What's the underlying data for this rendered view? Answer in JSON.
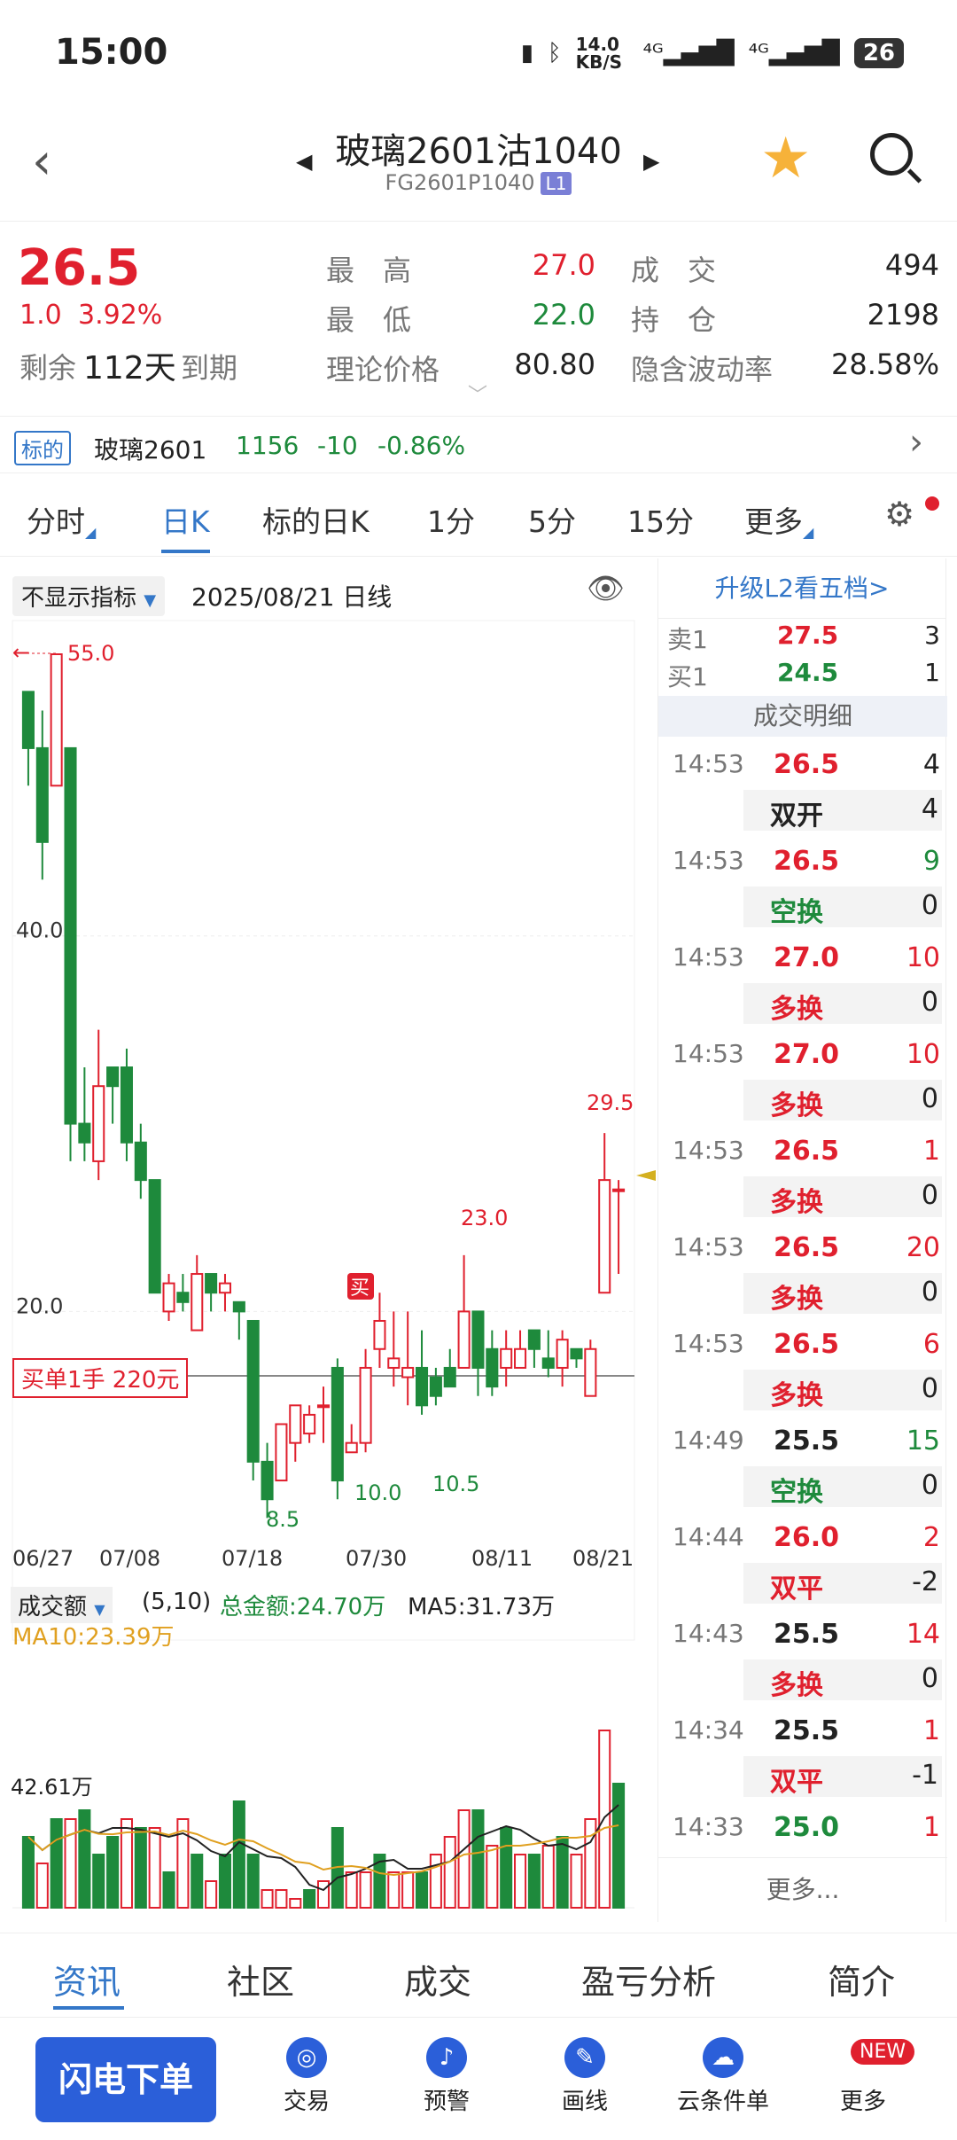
{
  "status": {
    "time": "15:00",
    "net_speed": "14.0 KB/S",
    "battery": "26"
  },
  "header": {
    "title": "玻璃2601沽1040",
    "code": "FG2601P1040",
    "level": "L1"
  },
  "quote": {
    "last": "26.5",
    "change": "1.0",
    "change_pct": "3.92%",
    "remain_label": "剩余",
    "remain_days": "112天",
    "remain_suffix": "到期",
    "high_label": "最　高",
    "high": "27.0",
    "low_label": "最　低",
    "low": "22.0",
    "theory_label": "理论价格",
    "theory": "80.80",
    "vol_label": "成　交",
    "vol": "494",
    "oi_label": "持　仓",
    "oi": "2198",
    "iv_label": "隐含波动率",
    "iv": "28.58%"
  },
  "underlying": {
    "tag": "标的",
    "name": "玻璃2601",
    "price": "1156",
    "chg": "-10",
    "pct": "-0.86%"
  },
  "tabs": [
    "分时",
    "日K",
    "标的日K",
    "1分",
    "5分",
    "15分",
    "更多"
  ],
  "chart_controls": {
    "indicator": "不显示指标",
    "date": "2025/08/21",
    "period": "日线"
  },
  "chart_data": {
    "type": "candlestick",
    "y_ticks": [
      "40.0",
      "20.0"
    ],
    "x_labels": [
      "06/27",
      "07/08",
      "07/18",
      "07/30",
      "08/11",
      "08/21"
    ],
    "annotations": {
      "max": "55.0",
      "min1": "8.5",
      "min2": "10.0",
      "min3": "10.5",
      "high1": "23.0",
      "high2": "29.5",
      "buy_tag": "买"
    },
    "order_line_label": "买单1手  220元",
    "candles": [
      {
        "o": 53,
        "c": 50,
        "h": 53,
        "l": 48
      },
      {
        "o": 50,
        "c": 45,
        "h": 52,
        "l": 43
      },
      {
        "o": 48,
        "c": 55,
        "h": 55,
        "l": 48
      },
      {
        "o": 50,
        "c": 30,
        "h": 50,
        "l": 28
      },
      {
        "o": 30,
        "c": 29,
        "h": 33,
        "l": 28
      },
      {
        "o": 28,
        "c": 32,
        "h": 35,
        "l": 27
      },
      {
        "o": 33,
        "c": 32,
        "h": 33,
        "l": 30
      },
      {
        "o": 33,
        "c": 29,
        "h": 34,
        "l": 28
      },
      {
        "o": 29,
        "c": 27,
        "h": 30,
        "l": 26
      },
      {
        "o": 27,
        "c": 21,
        "h": 27,
        "l": 21
      },
      {
        "o": 20,
        "c": 21.5,
        "h": 22,
        "l": 19.5
      },
      {
        "o": 21,
        "c": 20.5,
        "h": 22,
        "l": 20
      },
      {
        "o": 19,
        "c": 22,
        "h": 23,
        "l": 19
      },
      {
        "o": 22,
        "c": 21,
        "h": 22,
        "l": 20
      },
      {
        "o": 21,
        "c": 21.5,
        "h": 22,
        "l": 20
      },
      {
        "o": 20.5,
        "c": 20,
        "h": 20.5,
        "l": 18.5
      },
      {
        "o": 19.5,
        "c": 12,
        "h": 19.5,
        "l": 11
      },
      {
        "o": 12,
        "c": 10,
        "h": 13,
        "l": 9
      },
      {
        "o": 11,
        "c": 14,
        "h": 14,
        "l": 11
      },
      {
        "o": 13,
        "c": 15,
        "h": 15,
        "l": 12
      },
      {
        "o": 13.5,
        "c": 14.5,
        "h": 15,
        "l": 13
      },
      {
        "o": 15,
        "c": 15,
        "h": 16,
        "l": 13
      },
      {
        "o": 17,
        "c": 11,
        "h": 17.5,
        "l": 10
      },
      {
        "o": 12.5,
        "c": 13,
        "h": 14,
        "l": 12.5
      },
      {
        "o": 13,
        "c": 17,
        "h": 18,
        "l": 12.5
      },
      {
        "o": 18,
        "c": 19.5,
        "h": 21,
        "l": 17
      },
      {
        "o": 17,
        "c": 17.5,
        "h": 20,
        "l": 16
      },
      {
        "o": 16.5,
        "c": 17,
        "h": 20,
        "l": 15
      },
      {
        "o": 17,
        "c": 15,
        "h": 19,
        "l": 14.5
      },
      {
        "o": 16.5,
        "c": 15.5,
        "h": 17,
        "l": 15
      },
      {
        "o": 17,
        "c": 16,
        "h": 18,
        "l": 16
      },
      {
        "o": 17,
        "c": 20,
        "h": 23,
        "l": 17
      },
      {
        "o": 20,
        "c": 17,
        "h": 20,
        "l": 15.5
      },
      {
        "o": 18,
        "c": 16,
        "h": 19,
        "l": 15.5
      },
      {
        "o": 17,
        "c": 18,
        "h": 19,
        "l": 16
      },
      {
        "o": 17,
        "c": 18,
        "h": 19,
        "l": 17
      },
      {
        "o": 19,
        "c": 18,
        "h": 19,
        "l": 17
      },
      {
        "o": 17.5,
        "c": 17,
        "h": 19,
        "l": 16.5
      },
      {
        "o": 17,
        "c": 18.5,
        "h": 19,
        "l": 16
      },
      {
        "o": 18,
        "c": 17.5,
        "h": 18,
        "l": 17
      },
      {
        "o": 15.5,
        "c": 18,
        "h": 18.5,
        "l": 15.5
      },
      {
        "o": 21,
        "c": 27,
        "h": 29.5,
        "l": 21
      },
      {
        "o": 26.5,
        "c": 26.5,
        "h": 27,
        "l": 22
      }
    ]
  },
  "volume": {
    "label": "成交额",
    "params": "(5,10)",
    "total": "总金额:24.70万",
    "ma5": "MA5:31.73万",
    "ma10": "MA10:23.39万",
    "scale": "42.61万",
    "bars": [
      0.4,
      0.25,
      0.5,
      0.5,
      0.55,
      0.3,
      0.4,
      0.5,
      0.45,
      0.45,
      0.2,
      0.5,
      0.3,
      0.15,
      0.3,
      0.6,
      0.3,
      0.1,
      0.1,
      0.05,
      0.1,
      0.15,
      0.45,
      0.2,
      0.2,
      0.3,
      0.2,
      0.2,
      0.2,
      0.3,
      0.4,
      0.55,
      0.55,
      0.35,
      0.45,
      0.3,
      0.3,
      0.35,
      0.4,
      0.3,
      0.5,
      1.0,
      0.7
    ],
    "red": [
      false,
      true,
      false,
      true,
      false,
      false,
      false,
      true,
      false,
      true,
      false,
      true,
      false,
      true,
      false,
      false,
      false,
      true,
      true,
      true,
      false,
      true,
      false,
      true,
      true,
      false,
      true,
      true,
      false,
      true,
      true,
      true,
      false,
      true,
      false,
      true,
      false,
      true,
      false,
      true,
      true,
      true,
      false
    ]
  },
  "panel": {
    "upgrade": "升级L2看五档>",
    "ask": {
      "label": "卖1",
      "price": "27.5",
      "vol": "3"
    },
    "bid": {
      "label": "买1",
      "price": "24.5",
      "vol": "1"
    },
    "detail_title": "成交明细",
    "trades": [
      {
        "t": "14:53",
        "p": "26.5",
        "v": "4",
        "type": "双开",
        "tv": "4",
        "pc": "red",
        "vc": "gray",
        "tc": "gray"
      },
      {
        "t": "14:53",
        "p": "26.5",
        "v": "9",
        "type": "空换",
        "tv": "0",
        "pc": "red",
        "vc": "green",
        "tc": "green"
      },
      {
        "t": "14:53",
        "p": "27.0",
        "v": "10",
        "type": "多换",
        "tv": "0",
        "pc": "red",
        "vc": "red",
        "tc": "red"
      },
      {
        "t": "14:53",
        "p": "27.0",
        "v": "10",
        "type": "多换",
        "tv": "0",
        "pc": "red",
        "vc": "red",
        "tc": "red"
      },
      {
        "t": "14:53",
        "p": "26.5",
        "v": "1",
        "type": "多换",
        "tv": "0",
        "pc": "red",
        "vc": "red",
        "tc": "red"
      },
      {
        "t": "14:53",
        "p": "26.5",
        "v": "20",
        "type": "多换",
        "tv": "0",
        "pc": "red",
        "vc": "red",
        "tc": "red"
      },
      {
        "t": "14:53",
        "p": "26.5",
        "v": "6",
        "type": "多换",
        "tv": "0",
        "pc": "red",
        "vc": "red",
        "tc": "red"
      },
      {
        "t": "14:49",
        "p": "25.5",
        "v": "15",
        "type": "空换",
        "tv": "0",
        "pc": "gray",
        "vc": "green",
        "tc": "green"
      },
      {
        "t": "14:44",
        "p": "26.0",
        "v": "2",
        "type": "双平",
        "tv": "-2",
        "pc": "red",
        "vc": "red",
        "tc": "red"
      },
      {
        "t": "14:43",
        "p": "25.5",
        "v": "14",
        "type": "多换",
        "tv": "0",
        "pc": "gray",
        "vc": "red",
        "tc": "red"
      },
      {
        "t": "14:34",
        "p": "25.5",
        "v": "1",
        "type": "双平",
        "tv": "-1",
        "pc": "gray",
        "vc": "red",
        "tc": "red"
      },
      {
        "t": "14:33",
        "p": "25.0",
        "v": "1",
        "type": "",
        "tv": "",
        "pc": "green",
        "vc": "red",
        "tc": "red"
      }
    ],
    "more": "更多..."
  },
  "bottom_tabs": [
    "资讯",
    "社区",
    "成交",
    "盈亏分析",
    "简介"
  ],
  "nav": {
    "flash": "闪电下单",
    "items": [
      "交易",
      "预警",
      "画线",
      "云条件单",
      "更多"
    ],
    "new_badge": "NEW"
  }
}
